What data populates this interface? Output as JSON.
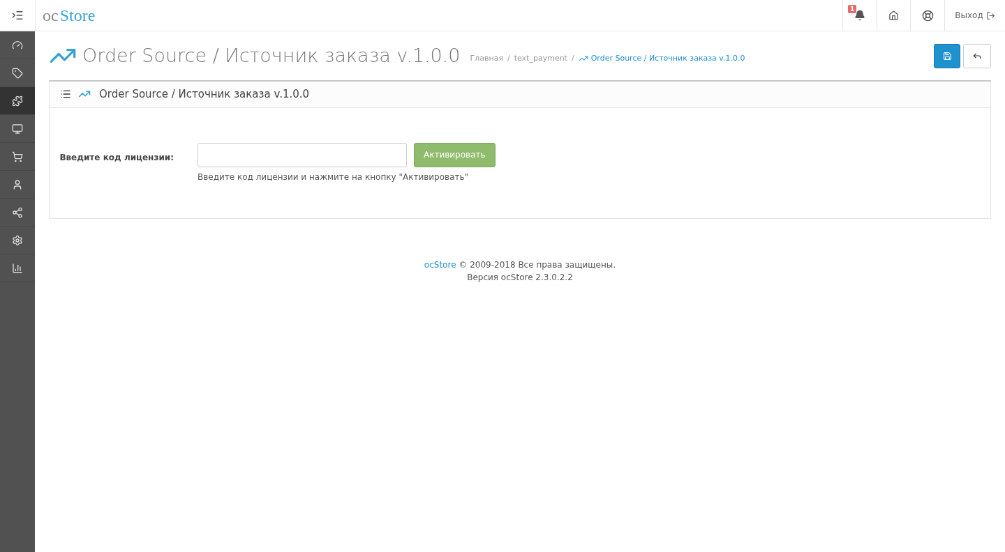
{
  "header": {
    "logo": {
      "prefix": "oc",
      "name": "Store"
    },
    "notification_count": "1",
    "logout": "Выход"
  },
  "sidebar": {
    "items": [
      {
        "kind": "dashboard",
        "selected": false
      },
      {
        "kind": "catalog",
        "selected": false
      },
      {
        "kind": "extensions",
        "selected": true
      },
      {
        "kind": "design",
        "selected": false
      },
      {
        "kind": "sales",
        "selected": false
      },
      {
        "kind": "customers",
        "selected": false
      },
      {
        "kind": "marketing",
        "selected": false
      },
      {
        "kind": "system",
        "selected": false
      },
      {
        "kind": "reports",
        "selected": false
      }
    ]
  },
  "page": {
    "title": "Order Source / Источник заказа v.1.0.0",
    "breadcrumb": [
      {
        "label": "Главная",
        "current": false
      },
      {
        "separator": "/",
        "label": "text_payment",
        "current": false
      },
      {
        "separator": "/",
        "label": "Order Source / Источник заказа v.1.0.0",
        "current": true
      }
    ]
  },
  "panel": {
    "title": "Order Source / Источник заказа v.1.0.0",
    "field_label": "Введите код лицензии:",
    "button": "Активировать",
    "help": "Введите код лицензии и нажмите на кнопку \"Активировать\""
  },
  "footer": {
    "link": "ocStore",
    "copyright": "© 2009-2018 Все права защищены.",
    "version": "Версия ocStore 2.3.0.2.2"
  }
}
